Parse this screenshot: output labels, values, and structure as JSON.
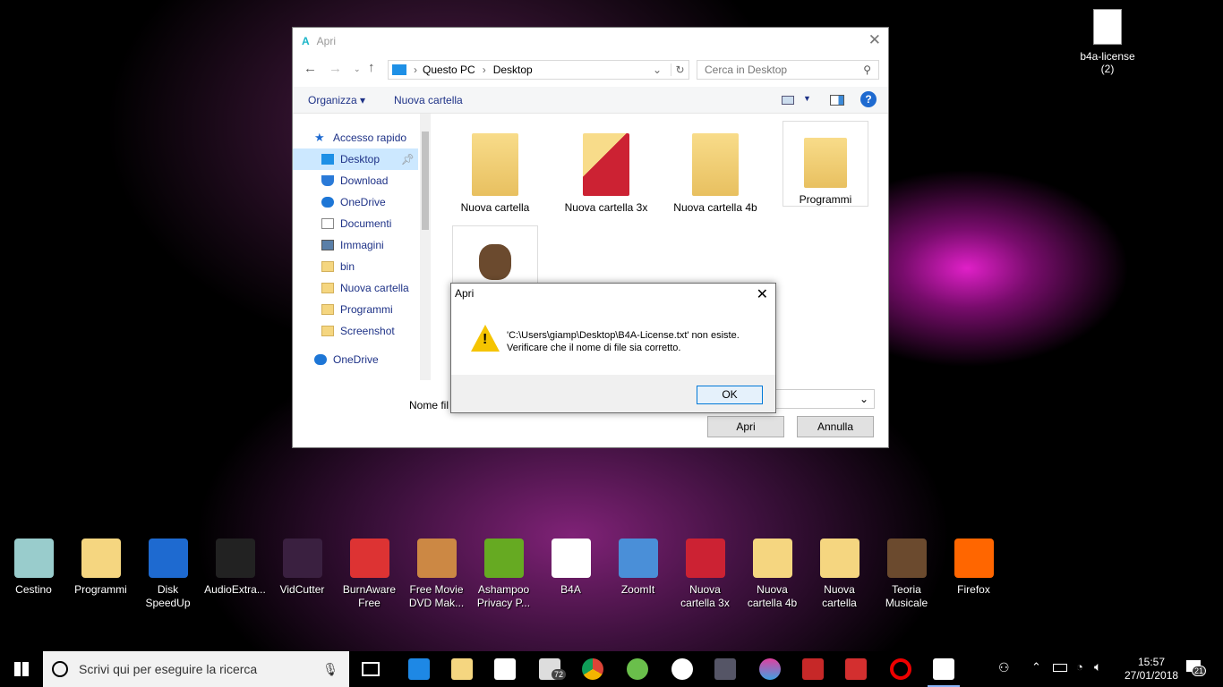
{
  "dialog": {
    "title": "Apri",
    "app_icon": "A",
    "address": [
      "Questo PC",
      "Desktop"
    ],
    "search_placeholder": "Cerca in Desktop",
    "toolbar": {
      "organize": "Organizza ▾",
      "new_folder": "Nuova cartella",
      "help": "?"
    },
    "sidebar": [
      {
        "label": "Accesso rapido",
        "icon": "star-icon"
      },
      {
        "label": "Desktop",
        "icon": "desktop-icon",
        "selected": true
      },
      {
        "label": "Download",
        "icon": "download-icon"
      },
      {
        "label": "OneDrive",
        "icon": "cloud-icon"
      },
      {
        "label": "Documenti",
        "icon": "document-icon"
      },
      {
        "label": "Immagini",
        "icon": "image-icon"
      },
      {
        "label": "bin",
        "icon": "folder-icon"
      },
      {
        "label": "Nuova cartella",
        "icon": "folder-icon"
      },
      {
        "label": "Programmi",
        "icon": "folder-icon"
      },
      {
        "label": "Screenshot",
        "icon": "folder-icon"
      },
      {
        "label": "OneDrive",
        "icon": "cloud-icon"
      }
    ],
    "files": [
      "Nuova cartella",
      "Nuova cartella 3x",
      "Nuova cartella 4b",
      "Programmi",
      ""
    ],
    "filename_label": "Nome fil",
    "filetype_suffix": "le",
    "open": "Apri",
    "cancel": "Annulla"
  },
  "message": {
    "title": "Apri",
    "line1": "'C:\\Users\\giamp\\Desktop\\B4A-License.txt' non esiste.",
    "line2": "Verificare che il nome di file sia corretto.",
    "ok": "OK"
  },
  "desktop_icons": [
    "Cestino",
    "Programmi",
    "Disk SpeedUp",
    "AudioExtra...",
    "VidCutter",
    "BurnAware Free",
    "Free Movie DVD Mak...",
    "Ashampoo Privacy P...",
    "B4A",
    "ZoomIt",
    "Nuova cartella 3x",
    "Nuova cartella 4b",
    "Nuova cartella",
    "Teoria Musicale",
    "Firefox"
  ],
  "top_icon": {
    "line1": "b4a-license",
    "line2": "(2)"
  },
  "taskbar": {
    "search": "Scrivi qui per eseguire la ricerca",
    "mail_badge": "72",
    "time": "15:57",
    "date": "27/01/2018",
    "notifications": "21"
  }
}
